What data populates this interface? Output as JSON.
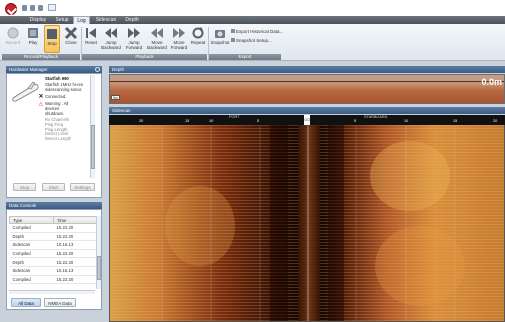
{
  "app": {
    "tabs": [
      "Display",
      "Setup",
      "Log",
      "Sidescan",
      "Depth"
    ],
    "active_tab": "Log"
  },
  "ribbon": {
    "buttons": [
      {
        "label": "Record",
        "icon": "record-icon",
        "state": "disabled"
      },
      {
        "label": "Play",
        "icon": "play-icon",
        "state": "normal"
      },
      {
        "label": "Stop",
        "icon": "stop-icon",
        "state": "active"
      },
      {
        "label": "Close",
        "icon": "close-icon",
        "state": "normal"
      },
      {
        "label": "Reset",
        "icon": "reset-icon",
        "state": "normal"
      },
      {
        "label": "Jump\nBackward",
        "icon": "jump-backward-icon",
        "state": "normal"
      },
      {
        "label": "Jump\nForward",
        "icon": "jump-forward-icon",
        "state": "normal"
      },
      {
        "label": "Move\nBackward",
        "icon": "move-backward-icon",
        "state": "normal"
      },
      {
        "label": "Move\nForward",
        "icon": "move-forward-icon",
        "state": "normal"
      },
      {
        "label": "Repeat",
        "icon": "repeat-icon",
        "state": "normal"
      },
      {
        "label": "Snapshot",
        "icon": "snapshot-icon",
        "state": "normal"
      }
    ],
    "small_buttons": [
      "Export Historical Data...",
      "Snapshot Setup..."
    ],
    "groups": [
      "Record/Playback",
      "Playback",
      "Export"
    ]
  },
  "hardware_panel": {
    "title": "Hardware Manager",
    "device_name": "Starfish 990",
    "device_desc": [
      "Starfish 1MHz hi-res",
      "sidescanning sonar."
    ],
    "status_connected": "Connected.",
    "warning": [
      "Warning : All",
      "devices",
      "shutdown."
    ],
    "details": [
      "Rx Channels",
      "Ping Freq",
      "Ping Length",
      "Detect Level",
      "Detect Length"
    ],
    "buttons": [
      "Stop",
      "Start",
      "Settings"
    ]
  },
  "data_console": {
    "title": "Data Console",
    "columns": [
      "Type",
      "Time"
    ],
    "rows": [
      [
        "Compiled",
        "15.22.20"
      ],
      [
        "Depth",
        "15.22.20"
      ],
      [
        "Sidescan",
        "10.16.13"
      ],
      [
        "Compiled",
        "15.22.20"
      ],
      [
        "Depth",
        "15.22.20"
      ],
      [
        "Sidescan",
        "10.16.13"
      ],
      [
        "Compiled",
        "15.22.20"
      ]
    ],
    "tabs": [
      "All Data",
      "NMEA Data"
    ],
    "active_tab": "All Data"
  },
  "depth_view": {
    "title": "Depth",
    "value": "0.0m",
    "scale": "5m"
  },
  "sidescan_view": {
    "title": "Sidescan",
    "port_label": "PORT",
    "starboard_label": "STARBOARD",
    "center_label": "0.0",
    "ticks_port": [
      "20",
      "15",
      "10",
      "5"
    ],
    "ticks_starboard": [
      "5",
      "10",
      "15",
      "20"
    ]
  },
  "colors": {
    "ribbon_active": "#f6c45b",
    "panel_header": "#4a6b93",
    "sonar_dark": "#2a0d05",
    "sonar_bright": "#f2b04a"
  }
}
